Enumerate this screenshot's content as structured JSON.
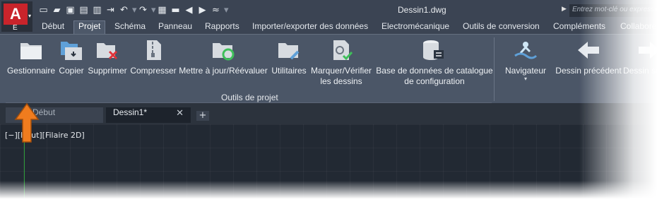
{
  "app": {
    "logo_letter": "A",
    "logo_sub": "E",
    "title": "Dessin1.dwg",
    "search_placeholder": "Entrez mot-clé ou expression"
  },
  "ribbon_tabs": [
    "Début",
    "Projet",
    "Schéma",
    "Panneau",
    "Rapports",
    "Importer/exporter des données",
    "Electromécanique",
    "Outils de conversion",
    "Compléments",
    "Collaborer"
  ],
  "active_tab": "Projet",
  "panel": {
    "title": "Outils de projet",
    "buttons": [
      {
        "line1": "Gestionnaire",
        "line2": ""
      },
      {
        "line1": "Copier",
        "line2": ""
      },
      {
        "line1": "Supprimer",
        "line2": ""
      },
      {
        "line1": "Compresser",
        "line2": ""
      },
      {
        "line1": "Mettre à jour/Réévaluer",
        "line2": ""
      },
      {
        "line1": "Utilitaires",
        "line2": ""
      },
      {
        "line1": "Marquer/Vérifier",
        "line2": "les dessins"
      },
      {
        "line1": "Base de données de catalogue",
        "line2": "de configuration"
      }
    ]
  },
  "nav_panel": {
    "navigator": "Navigateur",
    "previous": "Dessin précédent",
    "next": "Dessin suivant"
  },
  "doc_tabs": {
    "start": "Début",
    "active": "Dessin1*",
    "close": "✕",
    "new": "+"
  },
  "viewport": {
    "label": "[−][Haut][Filaire 2D]"
  },
  "colors": {
    "accent_red": "#c9242b",
    "annotation_orange": "#f07c1e",
    "ribbon_bg": "#4b5667"
  }
}
